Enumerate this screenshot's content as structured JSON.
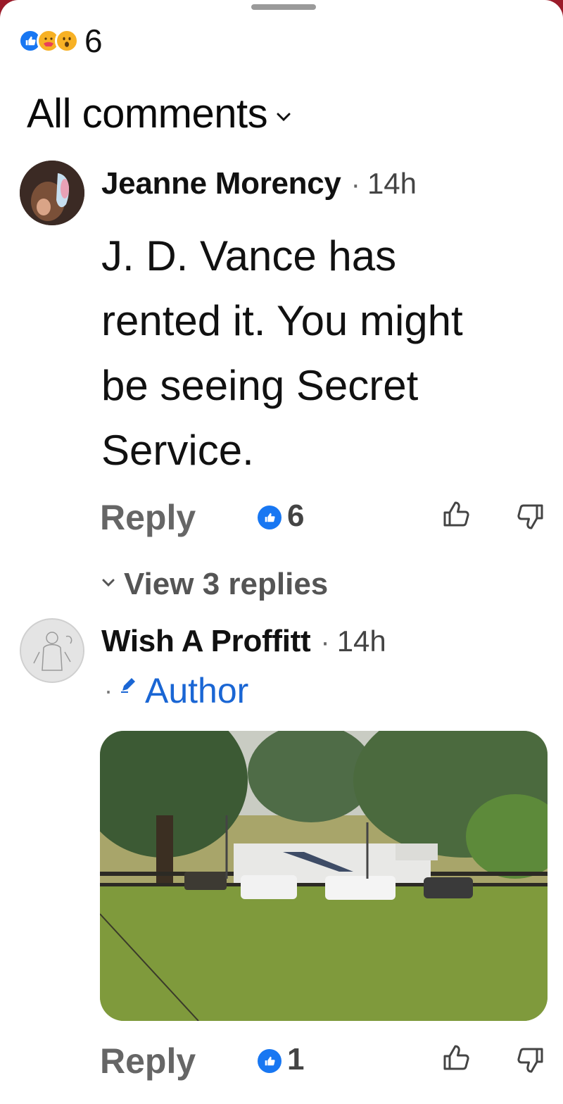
{
  "reactions": {
    "icons": [
      "like-icon",
      "care-icon",
      "wow-icon"
    ],
    "count": "6"
  },
  "filter": {
    "label": "All comments"
  },
  "comments": [
    {
      "author": "Jeanne Morency",
      "separator": "·",
      "time": "14h",
      "text": "J. D. Vance has rented it. You might be seeing Secret Service.",
      "reply_label": "Reply",
      "like_count": "6",
      "view_replies": "View 3 replies"
    },
    {
      "author": "Wish A Proffitt",
      "separator": "·",
      "time": "14h",
      "badge": "Author",
      "badge_dot": "·",
      "reply_label": "Reply",
      "like_count": "1"
    }
  ],
  "colors": {
    "accent": "#1877f2",
    "author_badge": "#1a66d4",
    "muted": "#666666",
    "background": "#ffffff"
  }
}
